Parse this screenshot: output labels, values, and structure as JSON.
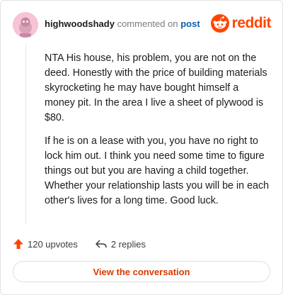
{
  "header": {
    "username": "highwoodshady",
    "commented_text": "commented on",
    "post_link": "post",
    "brand": "reddit"
  },
  "comment": {
    "paragraphs": [
      "NTA His house, his problem, you are not on the deed. Honestly with the price of building materials skyrocketing he may have bought himself a money pit. In the area I live a sheet of plywood is $80.",
      "If he is on a lease with you, you have no right to lock him out. I think you need some time to figure things out but you are having a child together. Whether your relationship lasts you will be in each other's lives for a long time. Good luck."
    ]
  },
  "actions": {
    "upvotes": "120 upvotes",
    "replies": "2 replies"
  },
  "cta": {
    "label": "View the conversation"
  },
  "colors": {
    "brand": "#ff4500",
    "link": "#0a5fb4",
    "cta_text": "#d93900"
  }
}
